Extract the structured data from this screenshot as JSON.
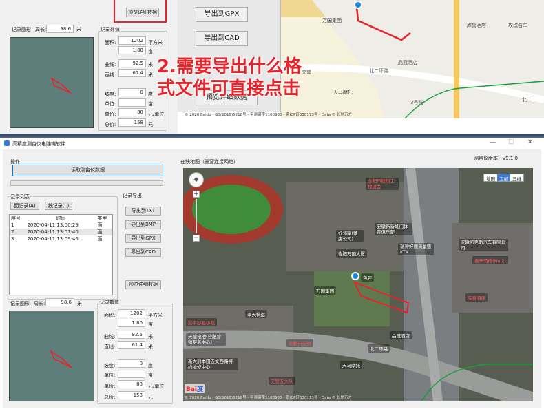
{
  "colors": {
    "accent": "#0078d7",
    "route": "#e8232a",
    "highway": "#f3c74a",
    "green_line": "#1aa03a",
    "overlay_text": "#e8232a",
    "overlay_stroke": "#ffffff"
  },
  "top": {
    "buttons": [
      "导出到GPX",
      "导出到CAD",
      "预览详细数据"
    ],
    "preview_label": "预览详细数据",
    "record_graph": "记录图形",
    "perimeter_label": "周长:",
    "perimeter_value": "98.6",
    "perimeter_unit": "米",
    "record_values": "记录数值",
    "rows": [
      {
        "label": "面积:",
        "v1": "1202",
        "u1": "平方米",
        "v2": "1.80",
        "u2": "亩"
      },
      {
        "label": "曲线:",
        "v1": "92.5",
        "u1": "米"
      },
      {
        "label": "直线:",
        "v1": "61.4",
        "u1": "米"
      }
    ],
    "extra": [
      {
        "label": "坡度:",
        "value": "0",
        "unit": "度"
      },
      {
        "label": "单位:",
        "value": "",
        "unit": "亩"
      },
      {
        "label": "单价:",
        "value": "88",
        "unit": "元/单位"
      },
      {
        "label": "总价:",
        "value": "158",
        "unit": "元"
      }
    ],
    "overlay_line1": "2.需要导出什么格",
    "overlay_line2": "式文件可直接点击",
    "map_labels": [
      "万国集团",
      "北二环路",
      "库鲁酒店",
      "攻瑰名车",
      "品冠酒店",
      "天马摩托",
      "交警",
      "3号线",
      "北二"
    ],
    "map_attribution": "© 2020 Baidu - GS(2019)5218号 - 甲测资字1100930 - 京ICP证030173号 - Data © 长地万方"
  },
  "window": {
    "title": "高精度测亩仪电脑端软件",
    "controls": [
      "—",
      "☐",
      "✕"
    ],
    "ops_label": "操作",
    "read_button": "读取测亩仪数据",
    "record_list_label": "记录列表",
    "tabs": [
      "面记录(A)",
      "线记录(L)"
    ],
    "columns": [
      "序号",
      "时间",
      "类型"
    ],
    "records": [
      {
        "id": "1",
        "time": "2020-04-11,13:00:29",
        "type": "面"
      },
      {
        "id": "2",
        "time": "2020-04-11,13:07:40",
        "type": "面"
      },
      {
        "id": "3",
        "time": "2020-04-11,13:09:46",
        "type": "面"
      }
    ],
    "export_label": "记录导出",
    "export_buttons": [
      "导出到TXT",
      "导出到BMP",
      "导出到GPX",
      "导出到CAD"
    ],
    "preview_button": "预览详细数据",
    "record_graph": "记录图形",
    "perimeter_label": "周长:",
    "perimeter_value": "98.6",
    "perimeter_unit": "米",
    "record_values": "记录数值",
    "area_label": "面积:",
    "area_value": "1202",
    "area_unit": "平方米",
    "mu_value": "1.80",
    "mu_unit": "亩",
    "curve_label": "曲线:",
    "curve_value": "92.5",
    "curve_unit": "米",
    "line_label": "直线:",
    "line_value": "61.4",
    "line_unit": "米",
    "slope_label": "坡度:",
    "slope_value": "0",
    "slope_unit": "度",
    "unit_label": "单位:",
    "unit_unit": "亩",
    "price_label": "单价:",
    "price_value": "88",
    "price_unit": "元/单位",
    "total_label": "总价:",
    "total_value": "158",
    "total_unit": "元",
    "online_map_label": "在线地图（需要连接网络）",
    "version": "测亩仪版本：v9.1.0",
    "map_types": [
      "地图",
      "卫星",
      "三维"
    ],
    "map_labels": [
      "合肥市建筑工程协会",
      "安徽新新虹门体育俱乐部",
      "好邻家(蒙店公司)",
      "合肥万国大厦",
      "瑞神好丽员量贩KTV",
      "安徽凯克斯汽车有限公司",
      "嘉禾酒楼(No.2)",
      "万国集团",
      "合肥市交警",
      "库香酒店",
      "品冠酒店",
      "天马摩托",
      "李天快运",
      "天能电池(合肥营销服务中心)",
      "交警五大队",
      "新大洲本田五文西路特约维修中心",
      "起平沙县小吃",
      "北二环路"
    ],
    "map_pin_label": "包腔",
    "map_attribution": "© 2020 Baidu - GS(2019)5218号 - 甲测资字1100930 - 京ICP证030173号 - Data © 长地万方"
  }
}
